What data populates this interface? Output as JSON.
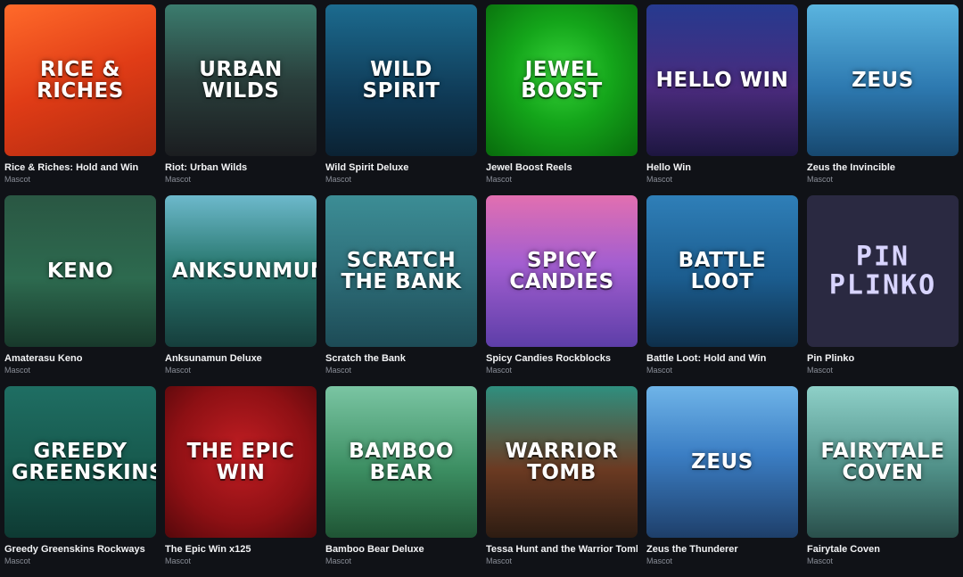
{
  "games": [
    {
      "title": "Rice & Riches: Hold and Win",
      "provider": "Mascot",
      "art_text": "Rice & Riches",
      "bg": "linear-gradient(160deg,#ff6a2a 0%,#e03c16 50%,#b02a10 100%)"
    },
    {
      "title": "Riot: Urban Wilds",
      "provider": "Mascot",
      "art_text": "Urban Wilds",
      "bg": "linear-gradient(180deg,#3b7c6e 0%,#2a3f3c 50%,#1b1d20 100%)"
    },
    {
      "title": "Wild Spirit Deluxe",
      "provider": "Mascot",
      "art_text": "Wild Spirit",
      "bg": "linear-gradient(180deg,#1c6b8f 0%,#0f3a56 60%,#0b2233 100%)"
    },
    {
      "title": "Jewel Boost Reels",
      "provider": "Mascot",
      "art_text": "Jewel Boost",
      "bg": "radial-gradient(circle at 50% 45%,#37d43a 0%,#14a51a 45%,#086b0c 100%)"
    },
    {
      "title": "Hello Win",
      "provider": "Mascot",
      "art_text": "Hello Win",
      "bg": "linear-gradient(180deg,#263a8f 0%,#4a2b7d 55%,#1d1640 100%)"
    },
    {
      "title": "Zeus the Invincible",
      "provider": "Mascot",
      "art_text": "Zeus",
      "bg": "linear-gradient(180deg,#5ab4df 0%,#2d79b0 55%,#17486f 100%)"
    },
    {
      "title": "Amaterasu Keno",
      "provider": "Mascot",
      "art_text": "Keno",
      "bg": "linear-gradient(180deg,#2a5743 0%,#2d6a4f 55%,#18392b 100%)"
    },
    {
      "title": "Anksunamun Deluxe",
      "provider": "Mascot",
      "art_text": "Anksunmun",
      "bg": "linear-gradient(180deg,#6db9cc 0%,#2b7a72 45%,#163e3c 100%)"
    },
    {
      "title": "Scratch the Bank",
      "provider": "Mascot",
      "art_text": "Scratch the Bank",
      "bg": "linear-gradient(180deg,#3c8d95 0%,#2e6f7a 50%,#1d4b56 100%)"
    },
    {
      "title": "Spicy Candies Rockblocks",
      "provider": "Mascot",
      "art_text": "Spicy Candies",
      "bg": "linear-gradient(180deg,#e26fb0 0%,#a35ed0 45%,#5d3ea8 100%)"
    },
    {
      "title": "Battle Loot: Hold and Win",
      "provider": "Mascot",
      "art_text": "Battle Loot",
      "bg": "linear-gradient(180deg,#2f7fb8 0%,#1b5c8e 55%,#0e2f4a 100%)"
    },
    {
      "title": "Pin Plinko",
      "provider": "Mascot",
      "art_text": "Pin Plinko",
      "bg": "#2a2941"
    },
    {
      "title": "Greedy Greenskins Rockways",
      "provider": "Mascot",
      "art_text": "Greedy Greenskins",
      "bg": "linear-gradient(180deg,#1f6e63 0%,#175a4e 50%,#0e3a33 100%)"
    },
    {
      "title": "The Epic Win x125",
      "provider": "Mascot",
      "art_text": "The Epic Win",
      "bg": "radial-gradient(circle at 50% 45%,#c21e23 0%,#8e1014 60%,#55080b 100%)"
    },
    {
      "title": "Bamboo Bear Deluxe",
      "provider": "Mascot",
      "art_text": "Bamboo Bear",
      "bg": "linear-gradient(180deg,#7ac5a3 0%,#3c8e62 55%,#1f5434 100%)"
    },
    {
      "title": "Tessa Hunt and the Warrior Tomb",
      "provider": "Mascot",
      "art_text": "Warrior Tomb",
      "bg": "linear-gradient(180deg,#2f8f7f 0%,#6b3a22 55%,#2d1c12 100%)"
    },
    {
      "title": "Zeus the Thunderer",
      "provider": "Mascot",
      "art_text": "Zeus",
      "bg": "linear-gradient(180deg,#6fb4e8 0%,#3b7ec4 45%,#1e3f6a 100%)"
    },
    {
      "title": "Fairytale Coven",
      "provider": "Mascot",
      "art_text": "Fairytale Coven",
      "bg": "linear-gradient(180deg,#8ed0c8 0%,#4f8f87 55%,#2a4f4b 100%)"
    }
  ]
}
